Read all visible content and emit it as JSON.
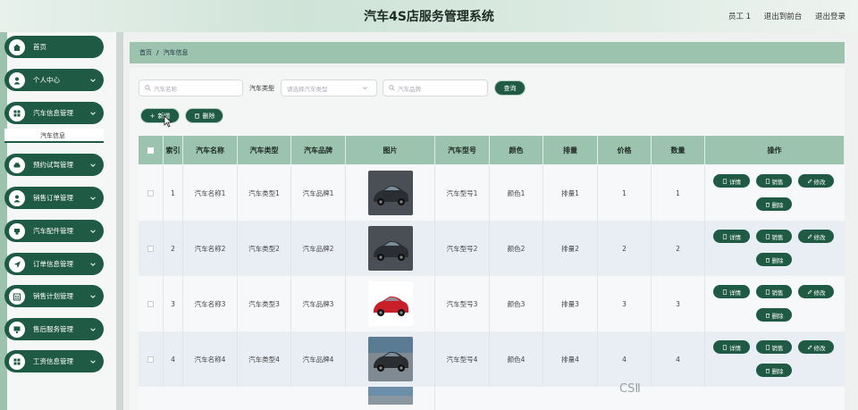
{
  "header": {
    "title": "汽车4S店服务管理系统",
    "user": "员工 1",
    "back_front": "退出到前台",
    "logout": "退出登录"
  },
  "sidebar": {
    "items": [
      {
        "label": "首页",
        "icon": "home-icon",
        "chevron": false
      },
      {
        "label": "个人中心",
        "icon": "user-icon",
        "chevron": true
      },
      {
        "label": "汽车信息管理",
        "icon": "grid-icon",
        "chevron": true
      },
      {
        "label": "预约试驾管理",
        "icon": "car-icon",
        "chevron": true
      },
      {
        "label": "销售订单管理",
        "icon": "user-icon",
        "chevron": true
      },
      {
        "label": "汽车配件管理",
        "icon": "parts-icon",
        "chevron": true
      },
      {
        "label": "订单信息管理",
        "icon": "send-icon",
        "chevron": true
      },
      {
        "label": "销售计划管理",
        "icon": "calendar-icon",
        "chevron": true
      },
      {
        "label": "售后服务管理",
        "icon": "monitor-icon",
        "chevron": true
      },
      {
        "label": "工资信息管理",
        "icon": "grid-icon",
        "chevron": true
      }
    ],
    "submenu_active": "汽车信息"
  },
  "breadcrumb": {
    "home": "首页",
    "sep": "/",
    "current": "汽车信息"
  },
  "search": {
    "name_placeholder": "汽车名称",
    "type_label": "汽车类型",
    "type_placeholder": "请选择汽车类型",
    "brand_placeholder": "汽车品牌",
    "query_button": "查询"
  },
  "actions": {
    "add": "新增",
    "delete": "删除"
  },
  "table": {
    "headers": [
      "索引",
      "汽车名称",
      "汽车类型",
      "汽车品牌",
      "图片",
      "汽车型号",
      "颜色",
      "排量",
      "价格",
      "数量",
      "操作"
    ],
    "rows": [
      {
        "index": "1",
        "name": "汽车名称1",
        "type": "汽车类型1",
        "brand": "汽车品牌1",
        "model": "汽车型号1",
        "color": "颜色1",
        "displacement": "排量1",
        "price": "1",
        "qty": "1"
      },
      {
        "index": "2",
        "name": "汽车名称2",
        "type": "汽车类型2",
        "brand": "汽车品牌2",
        "model": "汽车型号2",
        "color": "颜色2",
        "displacement": "排量2",
        "price": "2",
        "qty": "2"
      },
      {
        "index": "3",
        "name": "汽车名称3",
        "type": "汽车类型3",
        "brand": "汽车品牌3",
        "model": "汽车型号3",
        "color": "颜色3",
        "displacement": "排量3",
        "price": "3",
        "qty": "3"
      },
      {
        "index": "4",
        "name": "汽车名称4",
        "type": "汽车类型4",
        "brand": "汽车品牌4",
        "model": "汽车型号4",
        "color": "颜色4",
        "displacement": "排量4",
        "price": "4",
        "qty": "4"
      }
    ],
    "ops": {
      "detail": "详情",
      "sell": "销售",
      "edit": "修改",
      "delete": "删除"
    }
  },
  "watermark": "CSⅡ",
  "colors": {
    "accent": "#1f5a44",
    "header_bar": "#9bc3ad"
  }
}
